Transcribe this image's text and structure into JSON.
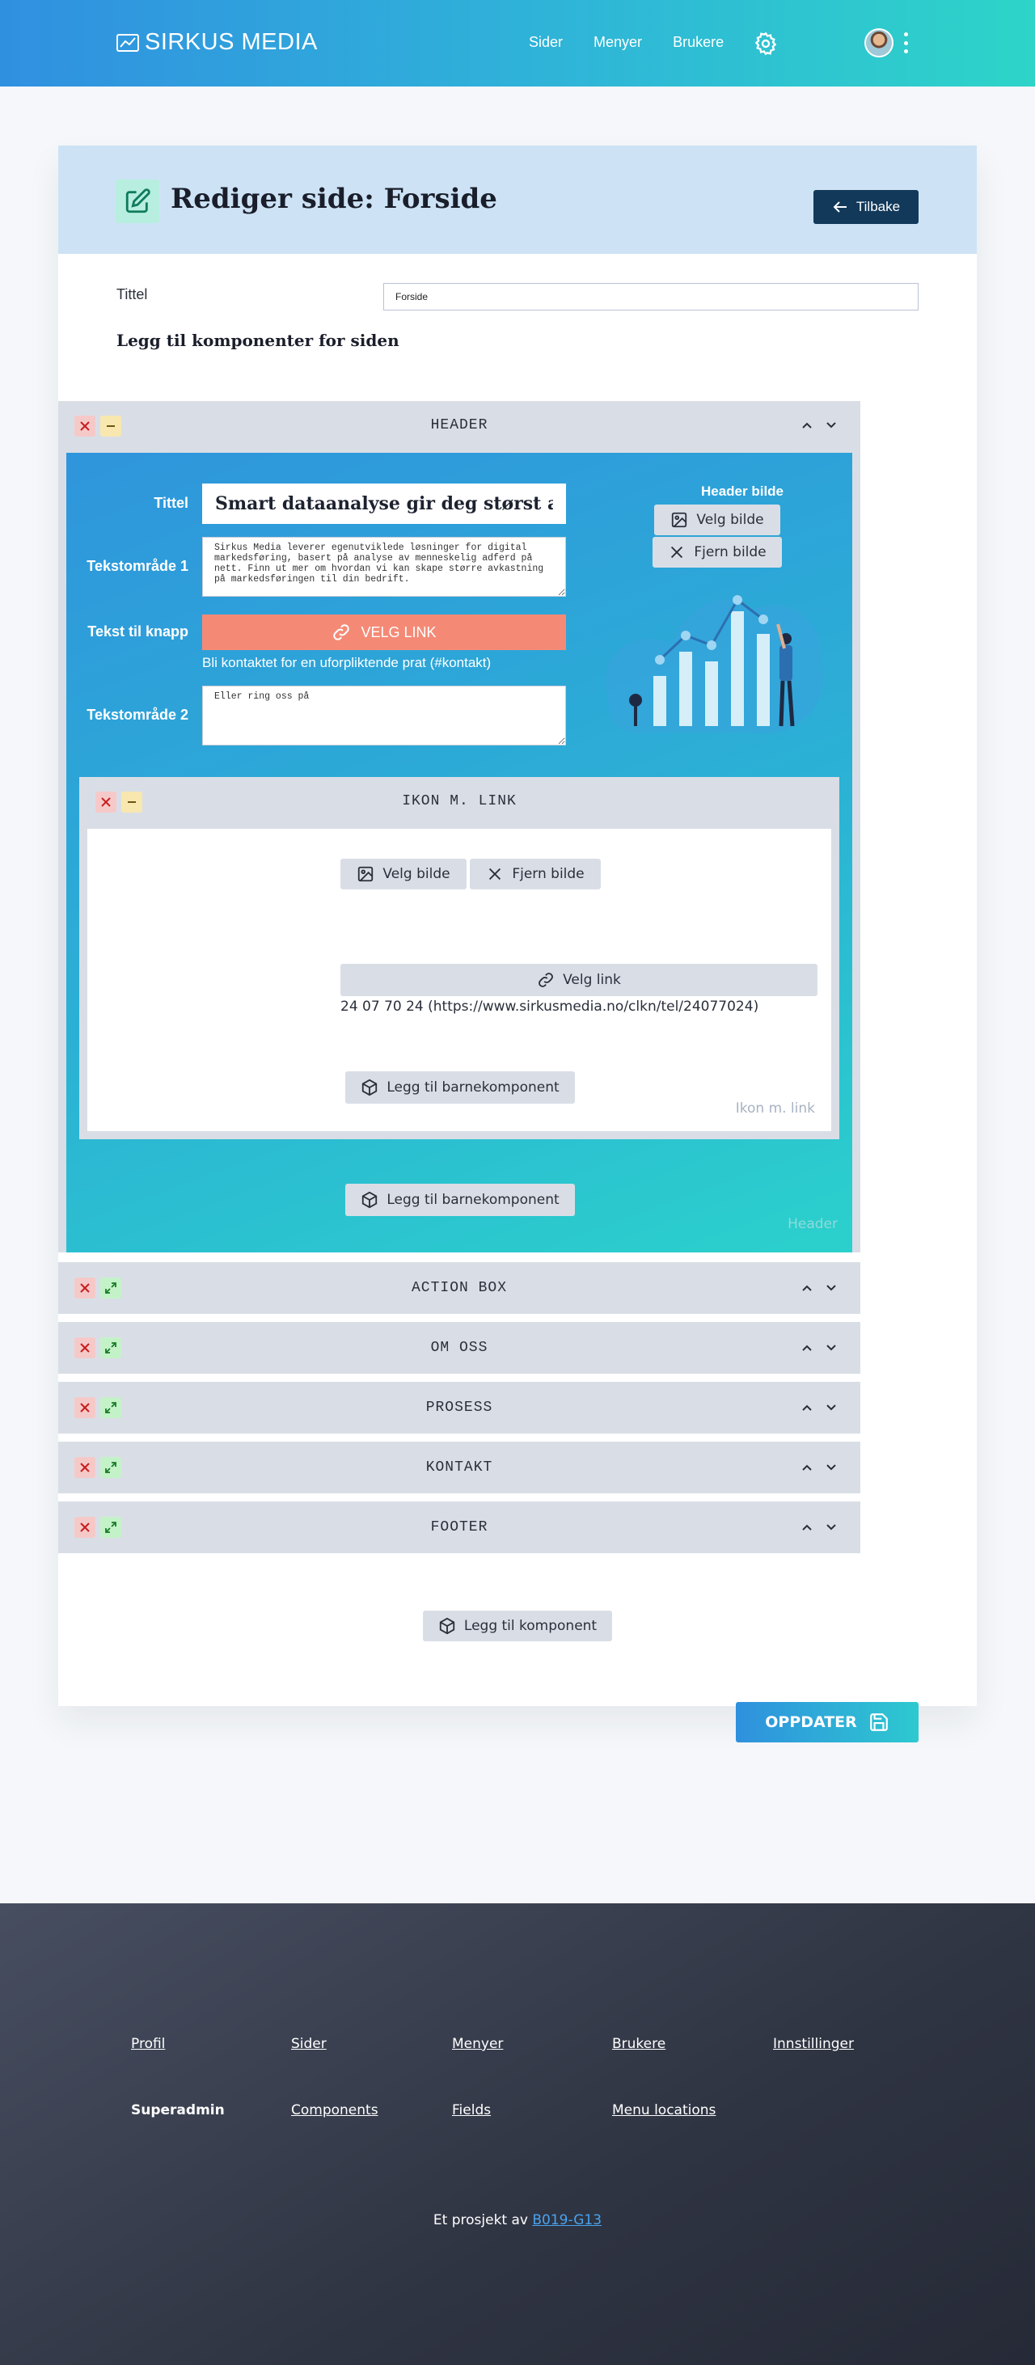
{
  "header": {
    "brand": "SIRKUS MEDIA",
    "nav": [
      "Sider",
      "Menyer",
      "Brukere"
    ]
  },
  "page": {
    "title": "Rediger side: Forside",
    "back_label": "Tilbake",
    "title_label": "Tittel",
    "title_value": "Forside",
    "components_heading": "Legg til komponenter for siden"
  },
  "header_component": {
    "name": "HEADER",
    "title_label": "Tittel",
    "title_value": "Smart dataanalyse gir deg størst avkastning",
    "text1_label": "Tekstområde 1",
    "text1_value": "Sirkus Media leverer egenutviklede løsninger for digital markedsføring, basert på analyse av menneskelig adferd på nett. Finn ut mer om hvordan vi kan skape større avkastning på markedsføringen til din bedrift.",
    "button_label": "Tekst til knapp",
    "button_text": "VELG LINK",
    "button_hint": "Bli kontaktet for en uforpliktende prat (#kontakt)",
    "text2_label": "Tekstområde 2",
    "text2_value": "Eller ring oss på",
    "image_label": "Header bilde",
    "choose_image": "Velg bilde",
    "remove_image": "Fjern bilde",
    "add_child": "Legg til barnekomponent",
    "watermark": "Header"
  },
  "ikon_component": {
    "name": "IKON M. LINK",
    "choose_image": "Velg bilde",
    "remove_image": "Fjern bilde",
    "choose_link": "Velg link",
    "link_text": "24 07 70 24 (https://www.sirkusmedia.no/clkn/tel/24077024)",
    "add_child": "Legg til barnekomponent",
    "watermark": "Ikon m. link"
  },
  "collapsed_components": [
    {
      "name": "ACTION BOX"
    },
    {
      "name": "OM OSS"
    },
    {
      "name": "PROSESS"
    },
    {
      "name": "KONTAKT"
    },
    {
      "name": "FOOTER"
    }
  ],
  "actions": {
    "add_component": "Legg til komponent",
    "update": "OPPDATER"
  },
  "footer": {
    "row1": [
      "Profil",
      "Sider",
      "Menyer",
      "Brukere",
      "Innstillinger"
    ],
    "role": "Superadmin",
    "row2": [
      "Components",
      "Fields",
      "Menu locations"
    ],
    "credit_prefix": "Et prosjekt av",
    "credit_link": "B019-G13"
  },
  "colors": {
    "accent_dark": "#12395a",
    "orange": "#f48a76",
    "gradient_start": "#3090e0",
    "gradient_end": "#2dd4c8"
  }
}
